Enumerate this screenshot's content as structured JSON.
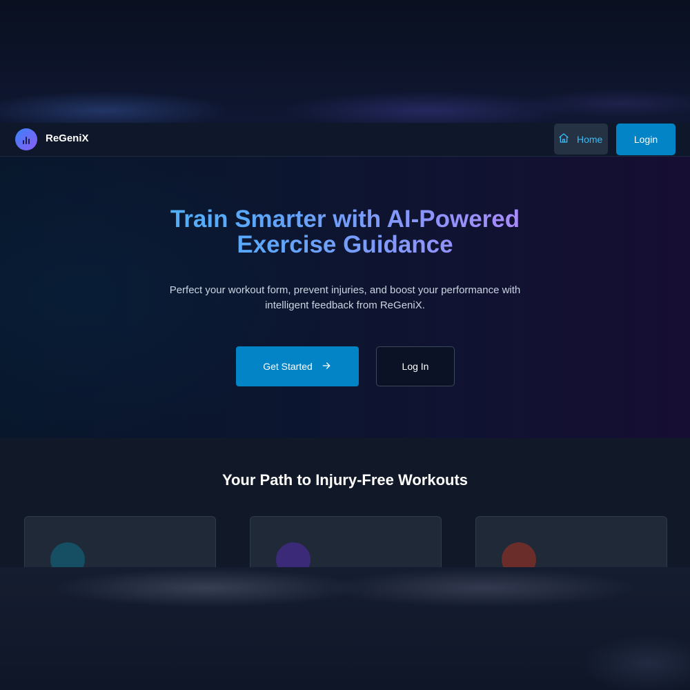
{
  "header": {
    "brand": "ReGeniX",
    "nav": {
      "home_label": "Home",
      "login_label": "Login"
    }
  },
  "hero": {
    "title_line1": "Train Smarter with AI-Powered",
    "title_line2": "Exercise Guidance",
    "subtitle_line1": "Perfect your workout form, prevent injuries, and boost your performance with",
    "subtitle_line2": "intelligent feedback from ReGeniX.",
    "primary_button": "Get Started",
    "secondary_button": "Log In"
  },
  "features": {
    "title": "Your Path to Injury-Free Workouts",
    "cards": [
      {
        "icon": "circle-icon",
        "color": "#164e63"
      },
      {
        "icon": "circle-icon",
        "color": "#3b2a78"
      },
      {
        "icon": "circle-icon",
        "color": "#6b2d2a"
      }
    ]
  },
  "colors": {
    "accent": "#0284c7",
    "home_link": "#38bdf8",
    "background": "#0f172a"
  }
}
